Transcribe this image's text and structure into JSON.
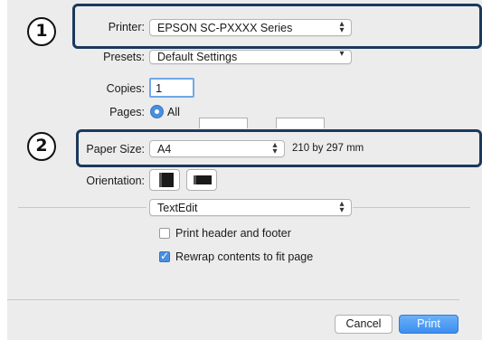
{
  "callouts": {
    "one": "1",
    "two": "2"
  },
  "printer": {
    "label": "Printer:",
    "value": "EPSON SC-PXXXX Series"
  },
  "presets": {
    "label": "Presets:",
    "value": "Default Settings"
  },
  "copies": {
    "label": "Copies:",
    "value": "1"
  },
  "pages": {
    "label": "Pages:",
    "all_label": "All"
  },
  "paper_size": {
    "label": "Paper Size:",
    "value": "A4",
    "dimensions": "210 by 297 mm"
  },
  "orientation": {
    "label": "Orientation:"
  },
  "section": {
    "value": "TextEdit"
  },
  "options": {
    "header_footer": {
      "label": "Print header and footer",
      "checked": false
    },
    "rewrap": {
      "label": "Rewrap contents to fit page",
      "checked": true
    }
  },
  "buttons": {
    "cancel": "Cancel",
    "print": "Print"
  },
  "colors": {
    "callout_border": "#1b3a5c",
    "accent": "#3b82f6",
    "dialog_bg": "#ececec"
  }
}
